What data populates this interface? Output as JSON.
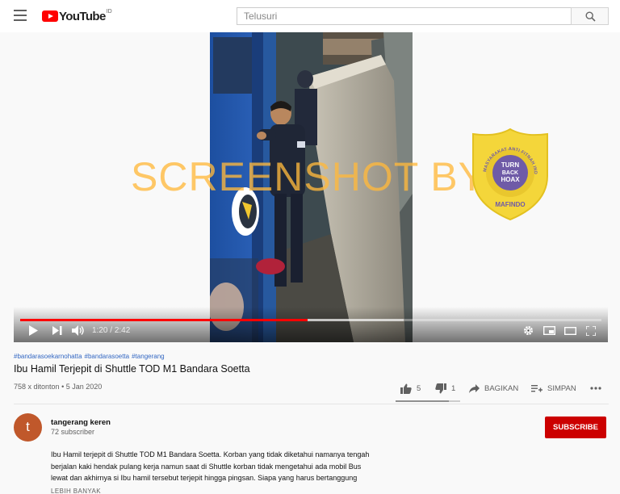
{
  "header": {
    "logo_text": "YouTube",
    "country_code": "ID",
    "search_placeholder": "Telusuri"
  },
  "player": {
    "current_time": "1:20",
    "duration": "2:42",
    "time_separator": " / ",
    "progress_fraction": 0.494,
    "buffer_fraction": 0.66,
    "watermark_text": "SCREENSHOT BY",
    "badge": {
      "ring_text": "MASYARAKAT ANTI FITNAH INDONESIA",
      "center_lines": [
        "TURN",
        "BACK",
        "HOAX"
      ],
      "bottom_text": "MAFINDO"
    }
  },
  "video": {
    "hashtags": [
      "#bandarasoekarnohatta",
      "#bandarasoetta",
      "#tangerang"
    ],
    "title": "Ibu Hamil Terjepit di Shuttle TOD M1 Bandara Soetta",
    "views": "758 x ditonton",
    "separator": "•",
    "date": "5 Jan 2020"
  },
  "actions": {
    "likes": "5",
    "dislikes": "1",
    "share_label": "BAGIKAN",
    "save_label": "SIMPAN",
    "like_fraction": 0.83
  },
  "channel": {
    "avatar_letter": "t",
    "name": "tangerang keren",
    "subscribers": "72 subscriber",
    "subscribe_label": "SUBSCRIBE"
  },
  "description": {
    "lines": [
      "Ibu Hamil terjepit di Shuttle TOD M1 Bandara Soetta. Korban yang tidak diketahui namanya tengah",
      "berjalan kaki hendak pulang kerja namun saat di Shuttle korban tidak mengetahui ada mobil Bus",
      "lewat dan akhirnya si Ibu hamil tersebut terjepit hingga pingsan. Siapa yang harus bertanggung"
    ],
    "show_more_label": "LEBIH BANYAK"
  },
  "colors": {
    "brand_red": "#ff0000",
    "subscribe_red": "#cc0000",
    "link_blue": "#3367c2",
    "watermark_orange": "#ffb83c",
    "badge_yellow": "#f4d63a",
    "badge_purple": "#6f5ba7"
  }
}
